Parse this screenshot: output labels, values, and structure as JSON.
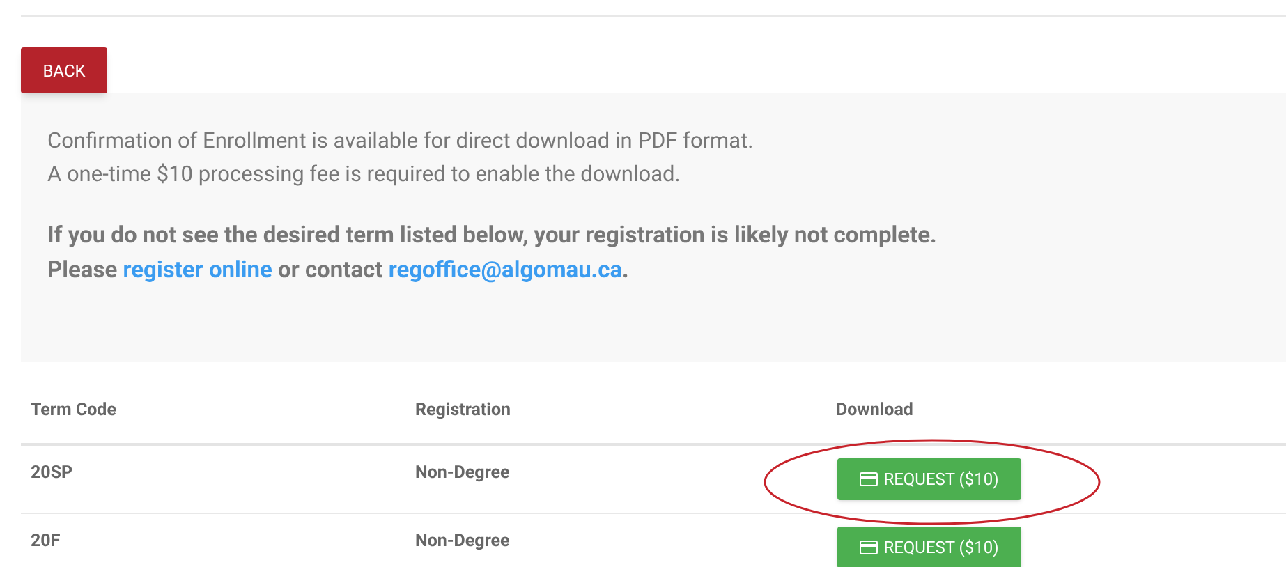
{
  "back_button": "BACK",
  "notice": {
    "lines": [
      "Confirmation of Enrollment is available for direct download in PDF format.",
      "A one-time $10 processing fee is required to enable the download."
    ],
    "warning": "If you do not see the desired term listed below, your registration is likely not complete.",
    "contact": {
      "before": "Please ",
      "link_1": "register online",
      "middle": " or contact ",
      "link_2": "regoffice@algomau.ca",
      "after": "."
    }
  },
  "table": {
    "columns": [
      "Term Code",
      "Registration",
      "Download"
    ],
    "rows": [
      {
        "term": "20SP",
        "registration": "Non-Degree",
        "button": "REQUEST ($10)",
        "highlighted": true
      },
      {
        "term": "20F",
        "registration": "Non-Degree",
        "button": "REQUEST ($10)",
        "highlighted": false
      }
    ]
  }
}
